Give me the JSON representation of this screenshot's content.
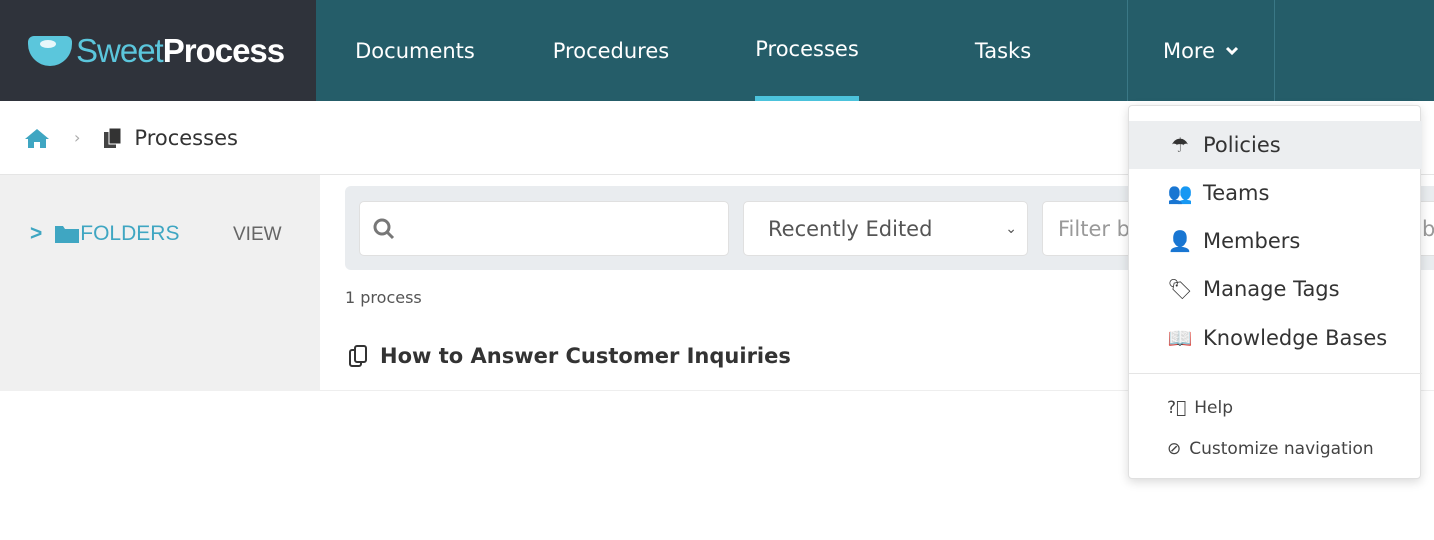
{
  "brand": {
    "part1": "Sweet",
    "part2": "Process"
  },
  "nav": {
    "items": [
      {
        "label": "Documents"
      },
      {
        "label": "Procedures"
      },
      {
        "label": "Processes"
      },
      {
        "label": "Tasks"
      }
    ],
    "active": "Processes",
    "more_label": "More"
  },
  "breadcrumb": {
    "current": "Processes"
  },
  "sidebar": {
    "folders_label": "FOLDERS",
    "view_label": "VIEW"
  },
  "filters": {
    "search_placeholder": "",
    "sort_value": "Recently Edited",
    "filter_placeholder": "Filter by",
    "filter2_placeholder": "by"
  },
  "list": {
    "count": "1 process",
    "items": [
      {
        "title": "How to Answer Customer Inquiries"
      }
    ]
  },
  "dropdown": {
    "items": [
      {
        "label": "Policies",
        "icon": "umbrella-icon"
      },
      {
        "label": "Teams",
        "icon": "users-icon"
      },
      {
        "label": "Members",
        "icon": "user-icon"
      },
      {
        "label": "Manage Tags",
        "icon": "tags-icon"
      },
      {
        "label": "Knowledge Bases",
        "icon": "book-icon"
      }
    ],
    "secondary": [
      {
        "label": "Help",
        "icon": "question-circle-icon"
      },
      {
        "label": "Customize navigation",
        "icon": "compass-icon"
      }
    ]
  },
  "colors": {
    "nav_bg": "#255d69",
    "logo_bg": "#2f333b",
    "accent": "#4cc3dc",
    "link": "#3fa6c2"
  }
}
